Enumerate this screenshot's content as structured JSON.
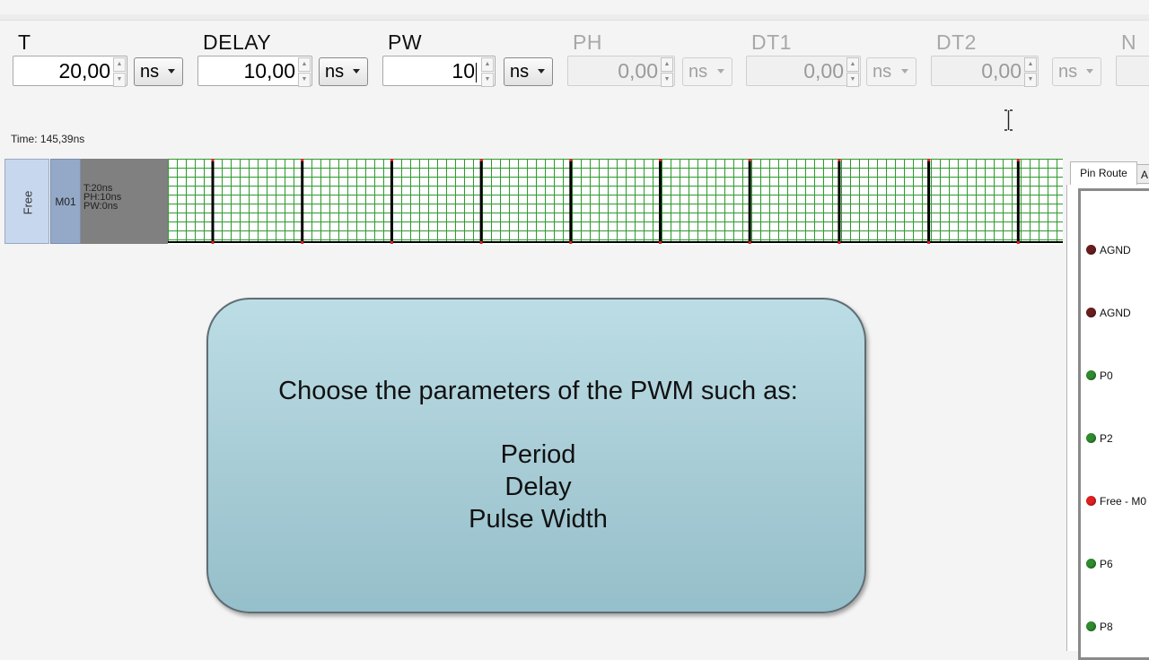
{
  "params": [
    {
      "label": "T",
      "value": "20,00",
      "unit": "ns",
      "enabled": true
    },
    {
      "label": "DELAY",
      "value": "10,00",
      "unit": "ns",
      "enabled": true
    },
    {
      "label": "PW",
      "value": "10",
      "unit": "ns",
      "enabled": true
    },
    {
      "label": "PH",
      "value": "0,00",
      "unit": "ns",
      "enabled": false
    },
    {
      "label": "DT1",
      "value": "0,00",
      "unit": "ns",
      "enabled": false
    },
    {
      "label": "DT2",
      "value": "0,00",
      "unit": "ns",
      "enabled": false
    },
    {
      "label": "N",
      "value": "",
      "unit": "",
      "enabled": false
    }
  ],
  "time_readout": "Time: 145,39ns",
  "timeline": {
    "free_label": "Free",
    "module_label": "M01",
    "info": [
      "T:20ns",
      "PH:10ns",
      "PW:0ns"
    ]
  },
  "side_tabs": {
    "active": "Pin Route",
    "second": "A"
  },
  "pins": [
    {
      "label": "AGND",
      "color": "#6b1d1d"
    },
    {
      "label": "AGND",
      "color": "#6b1d1d"
    },
    {
      "label": "P0",
      "color": "#2e8b2e"
    },
    {
      "label": "P2",
      "color": "#2e8b2e"
    },
    {
      "label": "Free - M0",
      "color": "#e02020"
    },
    {
      "label": "P6",
      "color": "#2e8b2e"
    },
    {
      "label": "P8",
      "color": "#2e8b2e"
    }
  ],
  "callout": {
    "heading": "Choose the parameters of the PWM such as:",
    "items": [
      "Period",
      "Delay",
      "Pulse Width"
    ]
  },
  "colors": {
    "grid": "#2d9a2d",
    "pulse": "#000000",
    "pulse_tip": "#e02020",
    "callout": "#a9cdd7"
  }
}
